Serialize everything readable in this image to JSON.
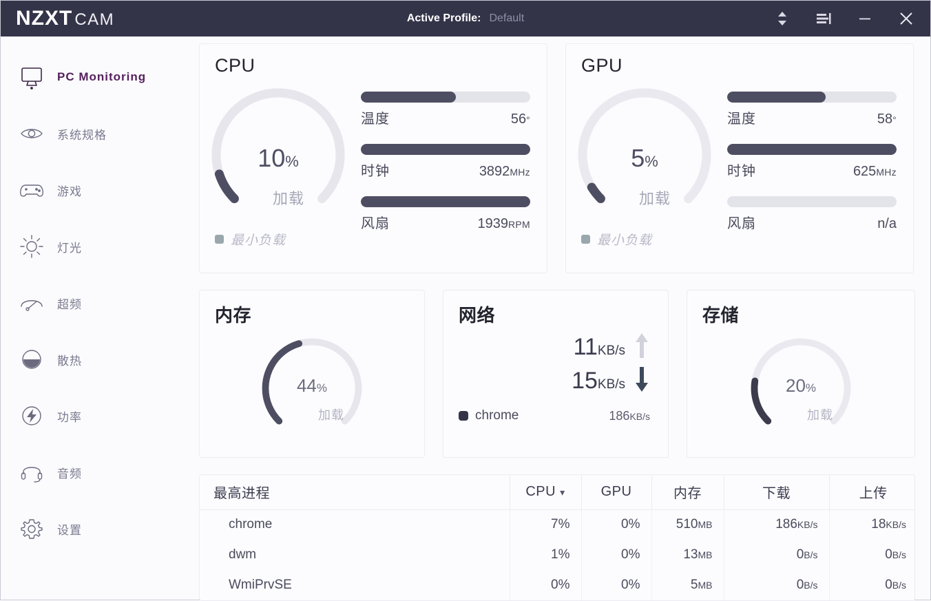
{
  "titlebar": {
    "logo_primary": "NZXT",
    "logo_secondary": "CAM",
    "profile_label": "Active Profile:",
    "profile_value": "Default",
    "selector_icon": "chevron-up-down-icon",
    "menu_icon": "menu-icon",
    "minimize_icon": "minimize-icon",
    "close_icon": "close-icon"
  },
  "sidebar": {
    "items": [
      {
        "label": "PC Monitoring",
        "icon": "monitor-icon",
        "active": true
      },
      {
        "label": "系统规格",
        "icon": "eye-icon",
        "active": false
      },
      {
        "label": "游戏",
        "icon": "gamepad-icon",
        "active": false
      },
      {
        "label": "灯光",
        "icon": "sun-icon",
        "active": false
      },
      {
        "label": "超频",
        "icon": "gauge-icon",
        "active": false
      },
      {
        "label": "散热",
        "icon": "cooling-icon",
        "active": false
      },
      {
        "label": "功率",
        "icon": "bolt-icon",
        "active": false
      },
      {
        "label": "音频",
        "icon": "headset-icon",
        "active": false
      },
      {
        "label": "设置",
        "icon": "gear-icon",
        "active": false
      }
    ]
  },
  "cpu_card": {
    "title": "CPU",
    "gauge_value": "10",
    "gauge_unit": "%",
    "gauge_percent": 10,
    "gauge_caption": "加载",
    "legend_text": "最小负载",
    "stats": [
      {
        "name": "温度",
        "value": "56",
        "unit": "°",
        "percent": 56
      },
      {
        "name": "时钟",
        "value": "3892",
        "unit": "MHz",
        "percent": 100
      },
      {
        "name": "风扇",
        "value": "1939",
        "unit": "RPM",
        "percent": 100
      }
    ]
  },
  "gpu_card": {
    "title": "GPU",
    "gauge_value": "5",
    "gauge_unit": "%",
    "gauge_percent": 5,
    "gauge_caption": "加载",
    "legend_text": "最小负载",
    "stats": [
      {
        "name": "温度",
        "value": "58",
        "unit": "°",
        "percent": 58
      },
      {
        "name": "时钟",
        "value": "625",
        "unit": "MHz",
        "percent": 100
      },
      {
        "name": "风扇",
        "value": "n/a",
        "unit": "",
        "percent": 0
      }
    ]
  },
  "memory_card": {
    "title": "内存",
    "gauge_value": "44",
    "gauge_unit": "%",
    "gauge_percent": 44,
    "gauge_caption": "加载"
  },
  "network_card": {
    "title": "网络",
    "upload_value": "11",
    "upload_unit": "KB/s",
    "upload_icon": "arrow-up-icon",
    "download_value": "15",
    "download_unit": "KB/s",
    "download_icon": "arrow-down-icon",
    "top_app_name": "chrome",
    "top_app_value": "186",
    "top_app_unit": "KB/s"
  },
  "storage_card": {
    "title": "存储",
    "gauge_value": "20",
    "gauge_unit": "%",
    "gauge_percent": 20,
    "gauge_caption": "加载"
  },
  "process_table": {
    "headers": {
      "name": "最高进程",
      "cpu": "CPU",
      "cpu_sort_icon": "chevron-down-icon",
      "gpu": "GPU",
      "memory": "内存",
      "download": "下载",
      "upload": "上传"
    },
    "rows": [
      {
        "name": "chrome",
        "cpu": "7%",
        "gpu": "0%",
        "mem_value": "510",
        "mem_unit": "MB",
        "dl_value": "186",
        "dl_unit": "KB/s",
        "ul_value": "18",
        "ul_unit": "KB/s"
      },
      {
        "name": "dwm",
        "cpu": "1%",
        "gpu": "0%",
        "mem_value": "13",
        "mem_unit": "MB",
        "dl_value": "0",
        "dl_unit": "B/s",
        "ul_value": "0",
        "ul_unit": "B/s"
      },
      {
        "name": "WmiPrvSE",
        "cpu": "0%",
        "gpu": "0%",
        "mem_value": "5",
        "mem_unit": "MB",
        "dl_value": "0",
        "dl_unit": "B/s",
        "ul_value": "0",
        "ul_unit": "B/s"
      }
    ]
  },
  "colors": {
    "titlebar_bg": "#343449",
    "accent_purple": "#56205e",
    "bar_fill": "#4e4e63",
    "bar_track": "#e3e3ea",
    "gauge_fill": "#4e4e63",
    "gauge_track": "#e6e6ec"
  }
}
